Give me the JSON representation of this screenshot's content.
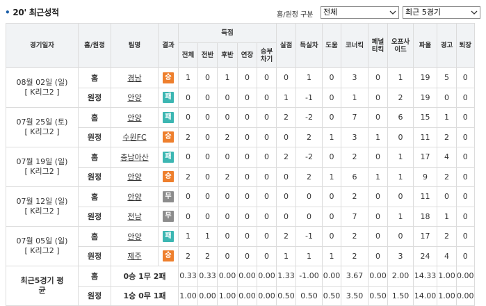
{
  "header": {
    "title": "20' 최근성적",
    "filter_label": "홈/원정 구분",
    "select_venue": "전체",
    "select_range": "최근 5경기"
  },
  "columns": {
    "date": "경기일자",
    "home_away": "홈/원정",
    "team": "팀명",
    "result": "결과",
    "goals_group": "득점",
    "goals_total": "전체",
    "goals_first": "전반",
    "goals_second": "후반",
    "goals_extra": "연장",
    "goals_pk": "승부차기",
    "conceded": "실점",
    "goal_diff": "득실차",
    "assists": "도움",
    "corners": "코너킥",
    "penalty_kicks": "페널티킥",
    "offsides": "오프사이드",
    "fouls": "파울",
    "yellow": "경고",
    "red": "퇴장"
  },
  "matches": [
    {
      "date": "08월 02일 (일)",
      "league": "[ K리그2 ]",
      "rows": [
        {
          "ha": "홈",
          "team": "경남",
          "result": "승",
          "rtype": "win",
          "stats": [
            "1",
            "0",
            "1",
            "0",
            "0",
            "0",
            "1",
            "0",
            "3",
            "0",
            "1",
            "19",
            "5",
            "0"
          ]
        },
        {
          "ha": "원정",
          "team": "안양",
          "result": "패",
          "rtype": "loss",
          "stats": [
            "0",
            "0",
            "0",
            "0",
            "0",
            "1",
            "-1",
            "0",
            "1",
            "0",
            "2",
            "19",
            "0",
            "0"
          ]
        }
      ]
    },
    {
      "date": "07월 25일 (토)",
      "league": "[ K리그2 ]",
      "rows": [
        {
          "ha": "홈",
          "team": "안양",
          "result": "패",
          "rtype": "loss",
          "stats": [
            "0",
            "0",
            "0",
            "0",
            "0",
            "2",
            "-2",
            "0",
            "7",
            "0",
            "6",
            "15",
            "1",
            "0"
          ]
        },
        {
          "ha": "원정",
          "team": "수원FC",
          "result": "승",
          "rtype": "win",
          "stats": [
            "2",
            "0",
            "2",
            "0",
            "0",
            "0",
            "2",
            "1",
            "3",
            "1",
            "0",
            "11",
            "2",
            "0"
          ]
        }
      ]
    },
    {
      "date": "07월 19일 (일)",
      "league": "[ K리그2 ]",
      "rows": [
        {
          "ha": "홈",
          "team": "충남아산",
          "result": "패",
          "rtype": "loss",
          "stats": [
            "0",
            "0",
            "0",
            "0",
            "0",
            "2",
            "-2",
            "0",
            "2",
            "0",
            "1",
            "17",
            "4",
            "0"
          ]
        },
        {
          "ha": "원정",
          "team": "안양",
          "result": "승",
          "rtype": "win",
          "stats": [
            "2",
            "0",
            "2",
            "0",
            "0",
            "0",
            "2",
            "1",
            "6",
            "1",
            "1",
            "9",
            "2",
            "0"
          ]
        }
      ]
    },
    {
      "date": "07월 12일 (일)",
      "league": "[ K리그2 ]",
      "rows": [
        {
          "ha": "홈",
          "team": "안양",
          "result": "무",
          "rtype": "draw",
          "stats": [
            "0",
            "0",
            "0",
            "0",
            "0",
            "0",
            "0",
            "0",
            "2",
            "0",
            "0",
            "11",
            "0",
            "0"
          ]
        },
        {
          "ha": "원정",
          "team": "전남",
          "result": "무",
          "rtype": "draw",
          "stats": [
            "0",
            "0",
            "0",
            "0",
            "0",
            "0",
            "0",
            "0",
            "7",
            "0",
            "1",
            "18",
            "1",
            "0"
          ]
        }
      ]
    },
    {
      "date": "07월 05일 (일)",
      "league": "[ K리그2 ]",
      "rows": [
        {
          "ha": "홈",
          "team": "안양",
          "result": "패",
          "rtype": "loss",
          "stats": [
            "1",
            "1",
            "0",
            "0",
            "0",
            "2",
            "-1",
            "0",
            "2",
            "0",
            "0",
            "17",
            "2",
            "0"
          ]
        },
        {
          "ha": "원정",
          "team": "제주",
          "result": "승",
          "rtype": "win",
          "stats": [
            "2",
            "2",
            "0",
            "0",
            "0",
            "1",
            "1",
            "1",
            "2",
            "0",
            "3",
            "24",
            "4",
            "0"
          ]
        }
      ]
    }
  ],
  "summary": {
    "label": "최근5경기 평균",
    "rows": [
      {
        "ha": "홈",
        "record": "0승 1무 2패",
        "stats": [
          "0.33",
          "0.33",
          "0.00",
          "0.00",
          "0.00",
          "1.33",
          "-1.00",
          "0.00",
          "3.67",
          "0.00",
          "2.00",
          "14.33",
          "1.00",
          "0.00"
        ]
      },
      {
        "ha": "원정",
        "record": "1승 0무 1패",
        "stats": [
          "1.00",
          "0.00",
          "1.00",
          "0.00",
          "0.00",
          "0.50",
          "0.50",
          "0.50",
          "3.50",
          "0.50",
          "1.50",
          "14.00",
          "1.00",
          "0.00"
        ]
      }
    ]
  },
  "colors": {
    "win": "#ee7f2d",
    "loss": "#3cb6b2",
    "draw": "#8c8c8c",
    "summary_label": "#2a5a8c"
  }
}
